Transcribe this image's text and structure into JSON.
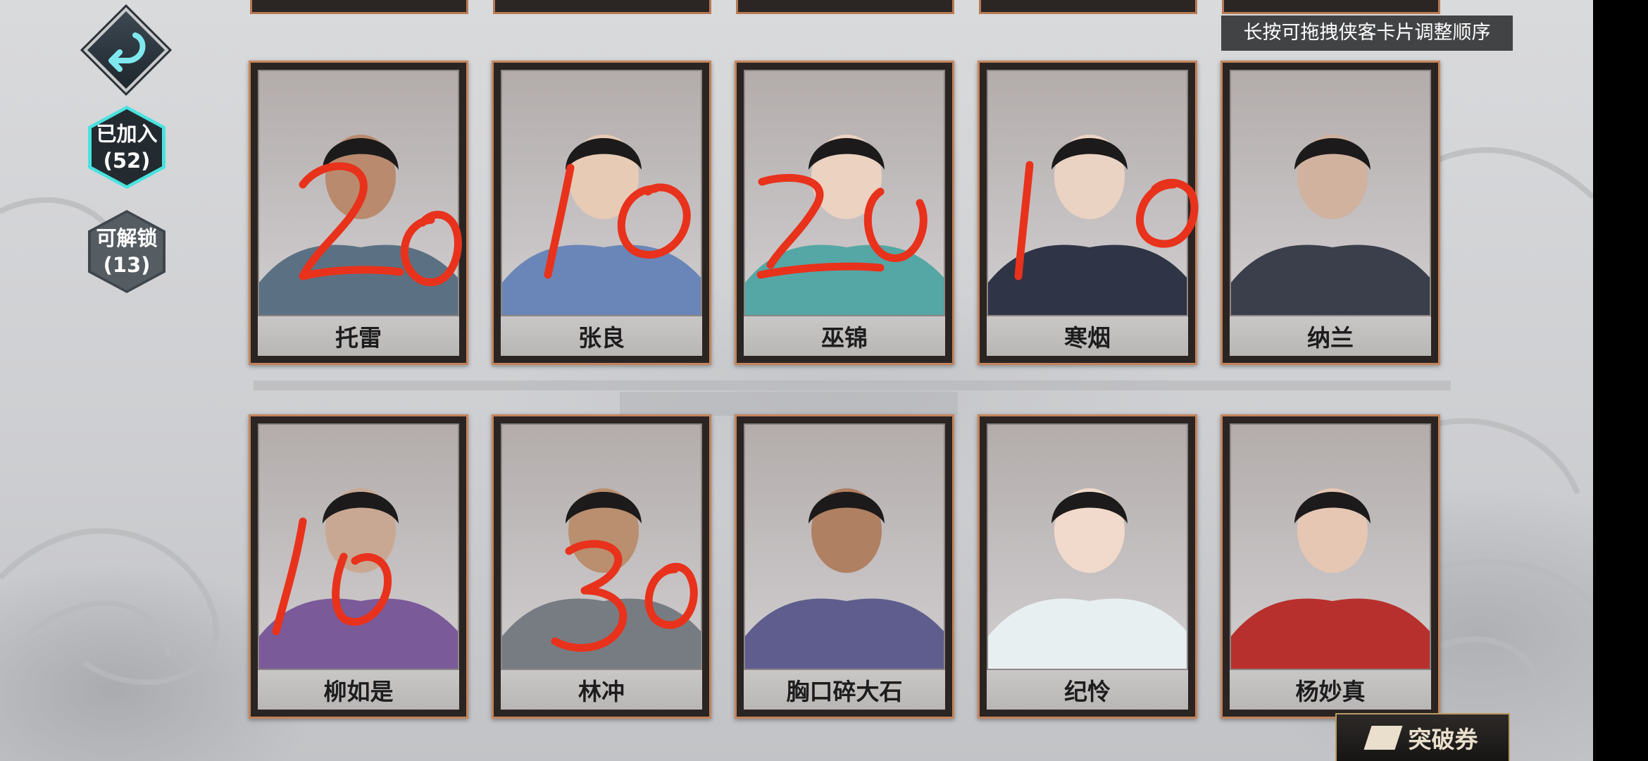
{
  "hint_text": "长按可拖拽侠客卡片调整顺序",
  "tabs": {
    "joined": {
      "label": "已加入",
      "count": "(52)"
    },
    "unlockable": {
      "label": "可解锁",
      "count": "(13)"
    }
  },
  "cards_row1": [
    {
      "name": "托雷",
      "skin": "#b98a6d",
      "cloth": "#5b7183"
    },
    {
      "name": "张良",
      "skin": "#e8cbb5",
      "cloth": "#6a86b8"
    },
    {
      "name": "巫锦",
      "skin": "#ecd2c1",
      "cloth": "#55a7a5"
    },
    {
      "name": "寒烟",
      "skin": "#ebd3c4",
      "cloth": "#2f3446"
    },
    {
      "name": "纳兰",
      "skin": "#d1b29f",
      "cloth": "#3b3f4b"
    }
  ],
  "cards_row2": [
    {
      "name": "柳如是",
      "skin": "#c9a893",
      "cloth": "#7b5a99"
    },
    {
      "name": "林冲",
      "skin": "#b98f70",
      "cloth": "#777c83"
    },
    {
      "name": "胸口碎大石",
      "skin": "#b08062",
      "cloth": "#5e5d8e"
    },
    {
      "name": "纪怜",
      "skin": "#f1dacb",
      "cloth": "#e8eff0"
    },
    {
      "name": "杨妙真",
      "skin": "#e6c7b3",
      "cloth": "#b8302d"
    }
  ],
  "annotations": [
    "20",
    "10",
    "20",
    "10",
    "10",
    "30"
  ],
  "ticket_label": "突破券",
  "colors": {
    "annotation": "#e8321c",
    "card_border": "#c4845c",
    "accent": "#49e3e0"
  },
  "icons": {
    "back": "back-arrow-icon"
  }
}
